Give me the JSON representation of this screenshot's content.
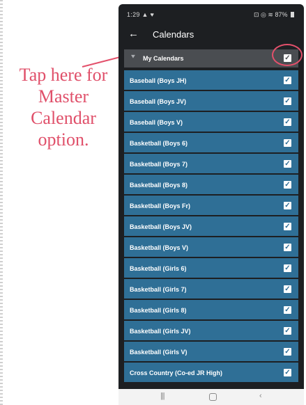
{
  "annotation": {
    "text": "Tap here for Master Calendar option.",
    "color": "#e0506a"
  },
  "status_bar": {
    "time": "1:29",
    "left_icons": "▲ ♥",
    "right_icons": "⊡ ◎ ≋",
    "battery": "87%"
  },
  "app_bar": {
    "back_icon": "arrow-left",
    "title": "Calendars"
  },
  "section": {
    "label": "My Calendars",
    "checked": true
  },
  "calendars": [
    {
      "label": "Baseball (Boys JH)",
      "checked": true
    },
    {
      "label": "Baseball (Boys JV)",
      "checked": true
    },
    {
      "label": "Baseball (Boys V)",
      "checked": true
    },
    {
      "label": "Basketball (Boys 6)",
      "checked": true
    },
    {
      "label": "Basketball (Boys 7)",
      "checked": true
    },
    {
      "label": "Basketball (Boys 8)",
      "checked": true
    },
    {
      "label": "Basketball (Boys Fr)",
      "checked": true
    },
    {
      "label": "Basketball (Boys JV)",
      "checked": true
    },
    {
      "label": "Basketball (Boys V)",
      "checked": true
    },
    {
      "label": "Basketball (Girls 6)",
      "checked": true
    },
    {
      "label": "Basketball (Girls 7)",
      "checked": true
    },
    {
      "label": "Basketball (Girls 8)",
      "checked": true
    },
    {
      "label": "Basketball (Girls JV)",
      "checked": true
    },
    {
      "label": "Basketball (Girls V)",
      "checked": true
    },
    {
      "label": "Cross Country (Co-ed JR High)",
      "checked": true
    }
  ],
  "nav_bar": {
    "recent_icon": "|||",
    "back_icon": "‹"
  },
  "colors": {
    "row_bg": "#2f6f96",
    "header_bg": "#4a4d51",
    "accent_red": "#e3506b"
  }
}
